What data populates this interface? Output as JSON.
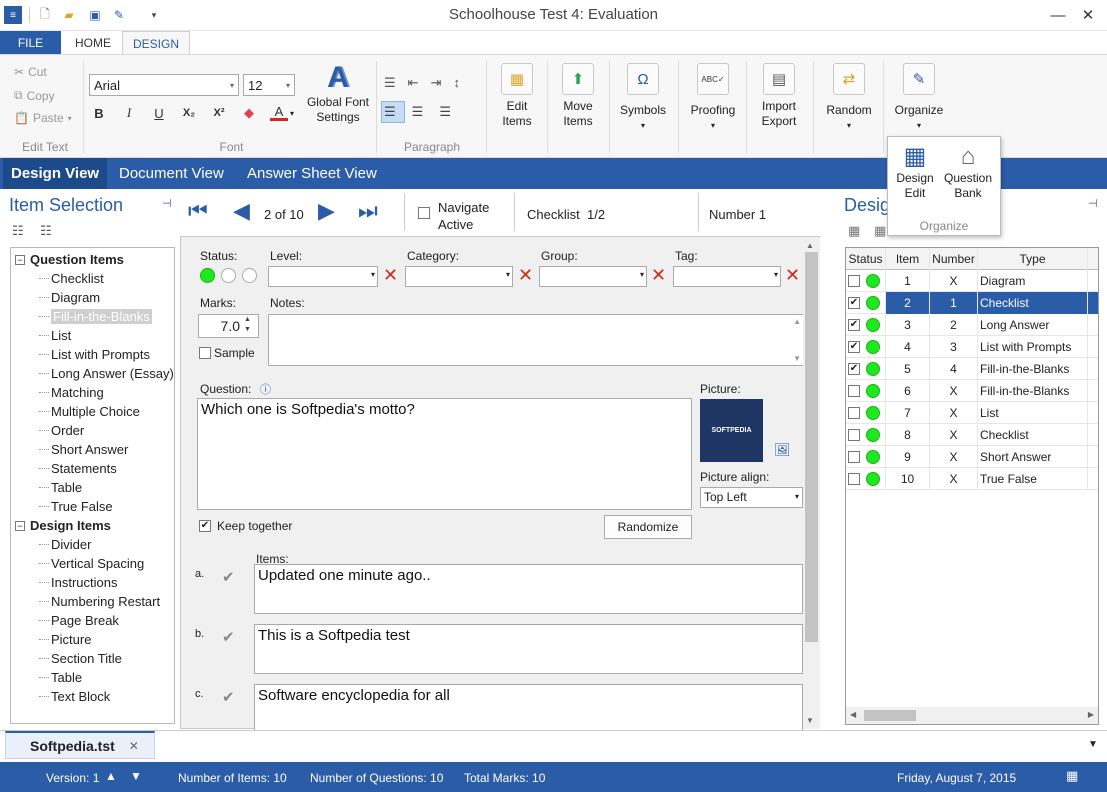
{
  "app": {
    "title": "Schoolhouse Test 4: Evaluation"
  },
  "ribbon_tabs": [
    "FILE",
    "HOME",
    "DESIGN"
  ],
  "ribbon": {
    "edit_text": {
      "cut": "Cut",
      "copy": "Copy",
      "paste": "Paste",
      "label": "Edit Text"
    },
    "font": {
      "family": "Arial",
      "size": "12",
      "bold": "B",
      "italic": "I",
      "underline": "U",
      "subscript": "X₂",
      "superscript": "X²",
      "global_font": "Global Font Settings",
      "label": "Font"
    },
    "paragraph": {
      "label": "Paragraph"
    },
    "edit_items": "Edit Items",
    "move_items": "Move Items",
    "symbols": "Symbols",
    "proofing": "Proofing",
    "import_export": "Import Export",
    "random": "Random",
    "organize": "Organize"
  },
  "organize_popup": {
    "design_edit": "Design Edit",
    "question_bank": "Question Bank",
    "label": "Organize"
  },
  "view_tabs": [
    "Design View",
    "Document View",
    "Answer Sheet View"
  ],
  "item_selection": {
    "title": "Item Selection",
    "question_items_label": "Question Items",
    "question_items": [
      "Checklist",
      "Diagram",
      "Fill-in-the-Blanks",
      "List",
      "List with Prompts",
      "Long Answer (Essay)",
      "Matching",
      "Multiple Choice",
      "Order",
      "Short Answer",
      "Statements",
      "Table",
      "True False"
    ],
    "design_items_label": "Design Items",
    "design_items": [
      "Divider",
      "Vertical Spacing",
      "Instructions",
      "Numbering Restart",
      "Page Break",
      "Picture",
      "Section Title",
      "Table",
      "Text Block"
    ]
  },
  "nav": {
    "position": "2 of 10",
    "navigate_active": "Navigate Active",
    "item_type": "Checklist",
    "item_part": "1/2",
    "number": "Number 1"
  },
  "form": {
    "status_label": "Status:",
    "level_label": "Level:",
    "category_label": "Category:",
    "group_label": "Group:",
    "tag_label": "Tag:",
    "marks_label": "Marks:",
    "marks_value": "7.0",
    "notes_label": "Notes:",
    "sample_label": "Sample",
    "question_label": "Question:",
    "question_text": "Which one is Softpedia's motto?",
    "picture_label": "Picture:",
    "picture_logo": "SOFTPEDIA",
    "picture_align_label": "Picture align:",
    "picture_align": "Top Left",
    "keep_together": "Keep together",
    "randomize": "Randomize",
    "items_label": "Items:",
    "items": [
      {
        "letter": "a.",
        "text": "Updated one minute ago.."
      },
      {
        "letter": "b.",
        "text": "This is a Softpedia test"
      },
      {
        "letter": "c.",
        "text": "Software encyclopedia for all"
      }
    ]
  },
  "design_panel": {
    "title": "Desig",
    "columns": [
      "Status",
      "Item",
      "Number",
      "Type"
    ],
    "rows": [
      {
        "checked": false,
        "item": "1",
        "number": "X",
        "type": "Diagram"
      },
      {
        "checked": true,
        "item": "2",
        "number": "1",
        "type": "Checklist",
        "selected": true
      },
      {
        "checked": true,
        "item": "3",
        "number": "2",
        "type": "Long Answer"
      },
      {
        "checked": true,
        "item": "4",
        "number": "3",
        "type": "List with Prompts"
      },
      {
        "checked": true,
        "item": "5",
        "number": "4",
        "type": "Fill-in-the-Blanks"
      },
      {
        "checked": false,
        "item": "6",
        "number": "X",
        "type": "Fill-in-the-Blanks"
      },
      {
        "checked": false,
        "item": "7",
        "number": "X",
        "type": "List"
      },
      {
        "checked": false,
        "item": "8",
        "number": "X",
        "type": "Checklist"
      },
      {
        "checked": false,
        "item": "9",
        "number": "X",
        "type": "Short Answer"
      },
      {
        "checked": false,
        "item": "10",
        "number": "X",
        "type": "True False"
      }
    ]
  },
  "document_tab": "Softpedia.tst",
  "statusbar": {
    "version": "Version: 1",
    "num_items": "Number of Items: 10",
    "num_questions": "Number of Questions: 10",
    "total_marks": "Total Marks: 10",
    "date": "Friday, August 7, 2015"
  },
  "colors": {
    "accent": "#2a5ca8",
    "status_green": "#1ee81e",
    "remove_red": "#d4281e"
  }
}
